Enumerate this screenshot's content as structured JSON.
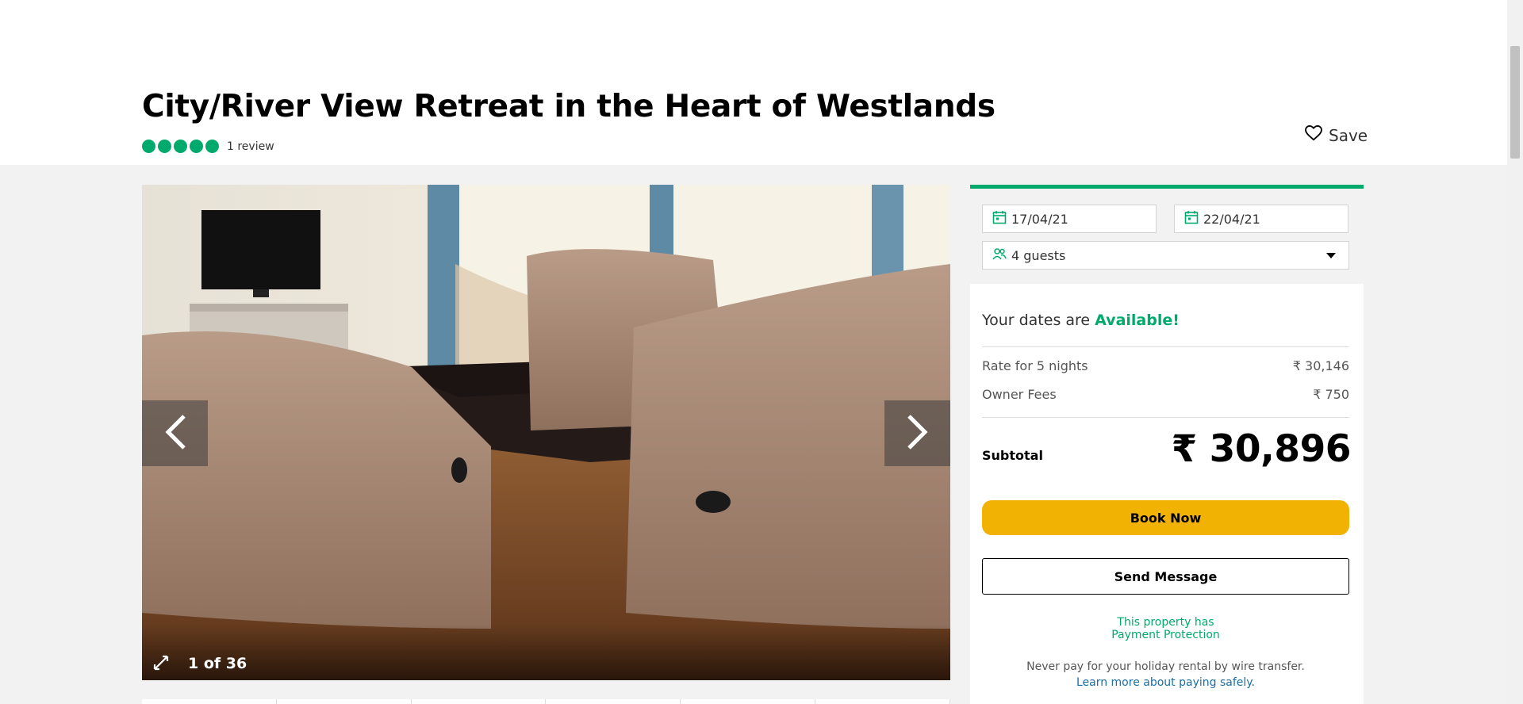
{
  "listing": {
    "title": "City/River View Retreat in the Heart of Westlands",
    "rating_bubbles": 5,
    "review_count": "1 review",
    "save_label": "Save"
  },
  "gallery": {
    "counter": "1 of 36",
    "total_photos": 36,
    "current_photo": 1
  },
  "booking": {
    "checkin": "17/04/21",
    "checkout": "22/04/21",
    "guests": "4 guests",
    "availability_prefix": "Your dates are",
    "availability_status": "Available!",
    "rate_label": "Rate for 5 nights",
    "rate_amount": "₹ 30,146",
    "fees_label": "Owner Fees",
    "fees_amount": "₹ 750",
    "subtotal_label": "Subtotal",
    "subtotal_amount": "₹ 30,896",
    "book_label": "Book Now",
    "message_label": "Send Message",
    "protection_line1": "This property has",
    "protection_line2": "Payment Protection",
    "wire_warning": "Never pay for your holiday rental by wire transfer.",
    "learn_more": "Learn more about paying safely."
  },
  "colors": {
    "accent_green": "#00aa6c",
    "book_yellow": "#f2b203",
    "link_blue": "#1a6fa8"
  },
  "icons": [
    "heart-icon",
    "calendar-icon",
    "guests-icon",
    "chevron-left-icon",
    "chevron-right-icon",
    "expand-icon",
    "dropdown-caret-icon"
  ]
}
